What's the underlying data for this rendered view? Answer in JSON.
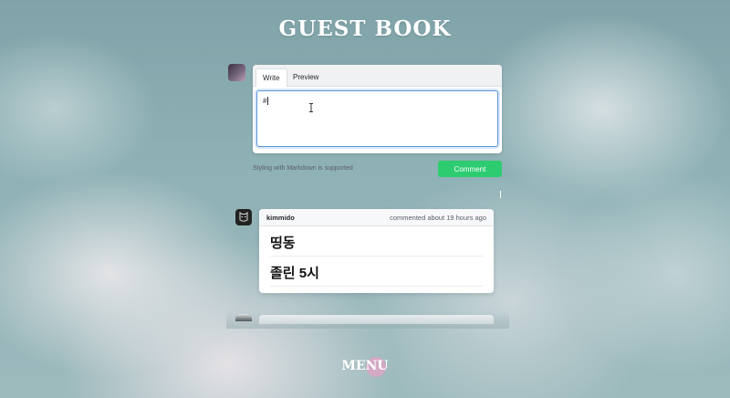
{
  "page": {
    "title": "GUEST BOOK"
  },
  "editor": {
    "tabs": [
      {
        "label": "Write"
      },
      {
        "label": "Preview"
      }
    ],
    "textarea_value": "#",
    "hint": "Styling with Markdown is supported",
    "submit_label": "Comment"
  },
  "comments": [
    {
      "author": "kimmido",
      "time": "commented about 19 hours ago",
      "lines": [
        "띵동",
        "졸린 5시"
      ]
    }
  ],
  "menu": {
    "label": "MENU"
  },
  "colors": {
    "accent_green": "#2ecc71",
    "focus_blue": "#5b95d6",
    "menu_dot": "#d8a6c4"
  }
}
